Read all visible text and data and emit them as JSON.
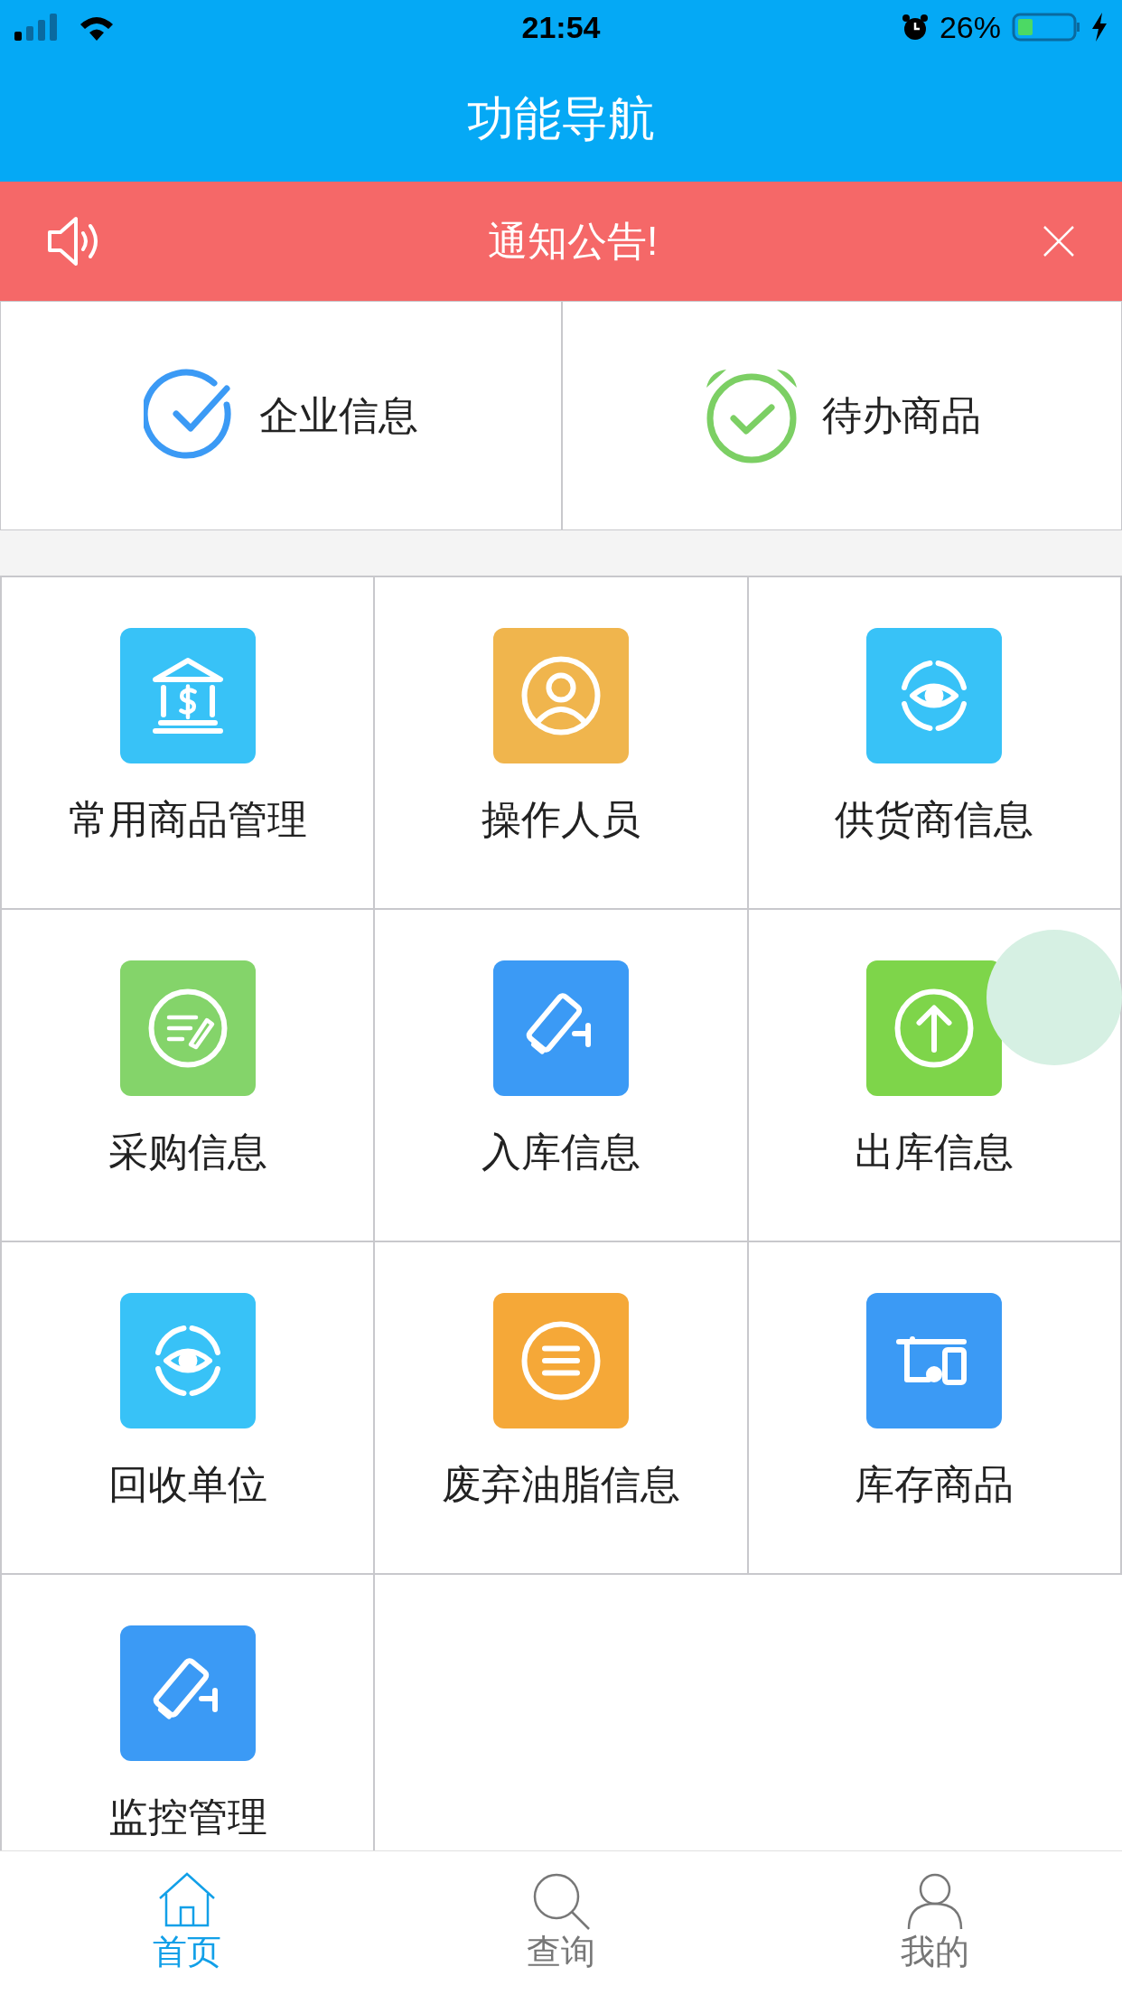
{
  "status_bar": {
    "time": "21:54",
    "battery": "26%"
  },
  "header": {
    "title": "功能导航"
  },
  "notice": {
    "text": "通知公告!"
  },
  "top_cards": [
    {
      "label": "企业信息",
      "kind": "check"
    },
    {
      "label": "待办商品",
      "kind": "alarm"
    }
  ],
  "grid": [
    {
      "label": "常用商品管理",
      "kind": "bank",
      "color": "#38c2f7"
    },
    {
      "label": "操作人员",
      "kind": "person",
      "color": "#f0b54d"
    },
    {
      "label": "供货商信息",
      "kind": "eye",
      "color": "#38c2f7"
    },
    {
      "label": "采购信息",
      "kind": "note",
      "color": "#84d46a"
    },
    {
      "label": "入库信息",
      "kind": "camera",
      "color": "#3b9af5"
    },
    {
      "label": "出库信息",
      "kind": "upload",
      "color": "#7ed54a"
    },
    {
      "label": "回收单位",
      "kind": "eye",
      "color": "#38c2f7"
    },
    {
      "label": "废弃油脂信息",
      "kind": "list",
      "color": "#f5a838"
    },
    {
      "label": "库存商品",
      "kind": "devices",
      "color": "#3b9af5"
    },
    {
      "label": "监控管理",
      "kind": "camera",
      "color": "#3b9af5"
    }
  ],
  "tab_bar": [
    {
      "label": "首页",
      "kind": "home",
      "selected": true
    },
    {
      "label": "查询",
      "kind": "search",
      "selected": false
    },
    {
      "label": "我的",
      "kind": "user",
      "selected": false
    }
  ]
}
